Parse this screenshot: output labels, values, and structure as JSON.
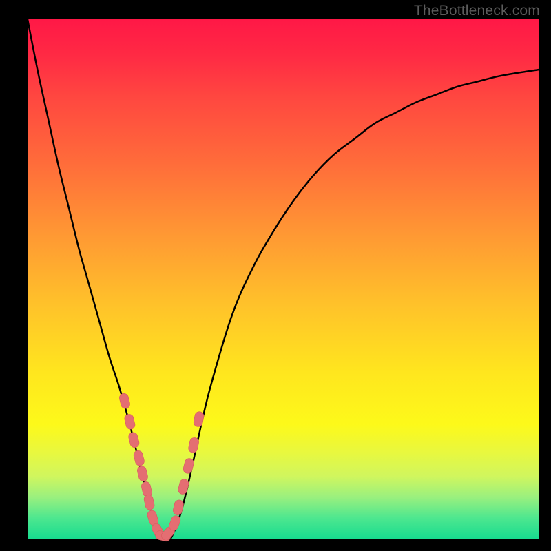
{
  "attribution": "TheBottleneck.com",
  "colors": {
    "frame": "#000000",
    "curve": "#000000",
    "marker_fill": "#e46e72",
    "marker_stroke": "#d85a5e"
  },
  "chart_data": {
    "type": "line",
    "title": "",
    "xlabel": "",
    "ylabel": "",
    "xlim": [
      0,
      100
    ],
    "ylim": [
      0,
      100
    ],
    "x": [
      0,
      2,
      4,
      6,
      8,
      10,
      12,
      14,
      16,
      18,
      20,
      22,
      23,
      24,
      25,
      26,
      27,
      28,
      30,
      32,
      34,
      36,
      40,
      44,
      48,
      52,
      56,
      60,
      64,
      68,
      72,
      76,
      80,
      84,
      88,
      92,
      96,
      100
    ],
    "values": [
      100,
      90,
      81,
      72,
      64,
      56,
      49,
      42,
      35,
      29,
      22,
      14,
      10,
      6,
      3,
      1,
      0,
      0,
      5,
      13,
      22,
      30,
      43,
      52,
      59,
      65,
      70,
      74,
      77,
      80,
      82,
      84,
      85.5,
      87,
      88,
      89,
      89.7,
      90.3
    ],
    "markers": {
      "x": [
        19.0,
        20.0,
        20.8,
        21.8,
        22.5,
        23.3,
        23.8,
        24.5,
        25.5,
        26.5,
        27.5,
        28.8,
        29.5,
        30.5,
        31.5,
        32.5,
        33.5
      ],
      "y": [
        26.5,
        22.5,
        19.0,
        15.5,
        12.5,
        9.5,
        7.0,
        4.0,
        1.5,
        0.5,
        1.0,
        3.0,
        6.0,
        10.0,
        14.0,
        18.0,
        23.0
      ]
    }
  }
}
